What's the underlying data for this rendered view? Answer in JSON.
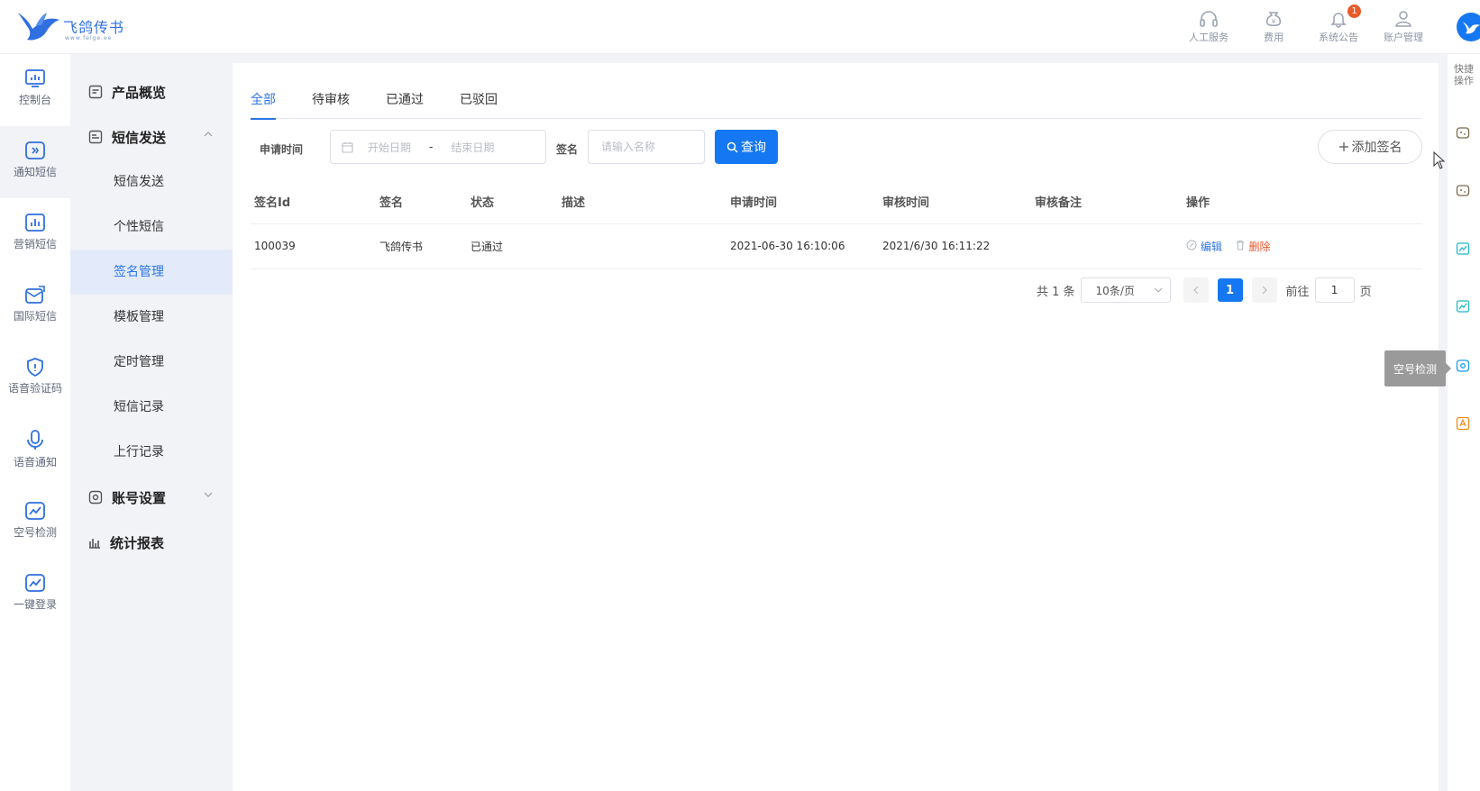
{
  "brand": {
    "name": "飞鸽传书",
    "sub": "www.feige.ee"
  },
  "header": {
    "actions": [
      {
        "label": "人工服务",
        "icon": "headset-icon"
      },
      {
        "label": "费用",
        "icon": "money-bag-icon"
      },
      {
        "label": "系统公告",
        "icon": "bell-icon",
        "badge": "1"
      },
      {
        "label": "账户管理",
        "icon": "user-icon"
      }
    ]
  },
  "leftnav": [
    {
      "label": "控制台",
      "icon": "dashboard-icon"
    },
    {
      "label": "通知短信",
      "icon": "notify-sms-icon",
      "active": true
    },
    {
      "label": "营销短信",
      "icon": "marketing-chart-icon"
    },
    {
      "label": "国际短信",
      "icon": "international-mail-icon"
    },
    {
      "label": "语音验证码",
      "icon": "voice-code-shield-icon"
    },
    {
      "label": "语音通知",
      "icon": "microphone-icon"
    },
    {
      "label": "空号检测",
      "icon": "empty-number-check-icon"
    },
    {
      "label": "一键登录",
      "icon": "one-click-login-icon"
    }
  ],
  "submenu": {
    "overview": "产品概览",
    "sms_send": "短信发送",
    "items": [
      "短信发送",
      "个性短信",
      "签名管理",
      "模板管理",
      "定时管理",
      "短信记录",
      "上行记录"
    ],
    "account": "账号设置",
    "report": "统计报表"
  },
  "tabs": [
    "全部",
    "待审核",
    "已通过",
    "已驳回"
  ],
  "filter": {
    "date_label": "申请时间",
    "start_placeholder": "开始日期",
    "separator": "-",
    "end_placeholder": "结束日期",
    "sig_label": "签名",
    "sig_placeholder": "请输入名称",
    "query": "查询",
    "add": "添加签名"
  },
  "table": {
    "headers": [
      "签名Id",
      "签名",
      "状态",
      "描述",
      "申请时间",
      "审核时间",
      "审核备注",
      "操作"
    ],
    "rows": [
      {
        "id": "100039",
        "name": "飞鸽传书",
        "status": "已通过",
        "desc": "",
        "apply_time": "2021-06-30 16:10:06",
        "review_time": "2021/6/30 16:11:22",
        "remark": "",
        "edit": "编辑",
        "delete": "删除"
      }
    ]
  },
  "pager": {
    "total": "共 1 条",
    "page_size": "10条/页",
    "current": "1",
    "goto_prefix": "前往",
    "goto_value": "1",
    "goto_suffix": "页"
  },
  "rightbar": {
    "title": "快捷操作",
    "tooltip": "空号检测"
  },
  "colors": {
    "primary": "#1578f2",
    "danger": "#e8552e",
    "active_bg": "#e3ebfa"
  }
}
